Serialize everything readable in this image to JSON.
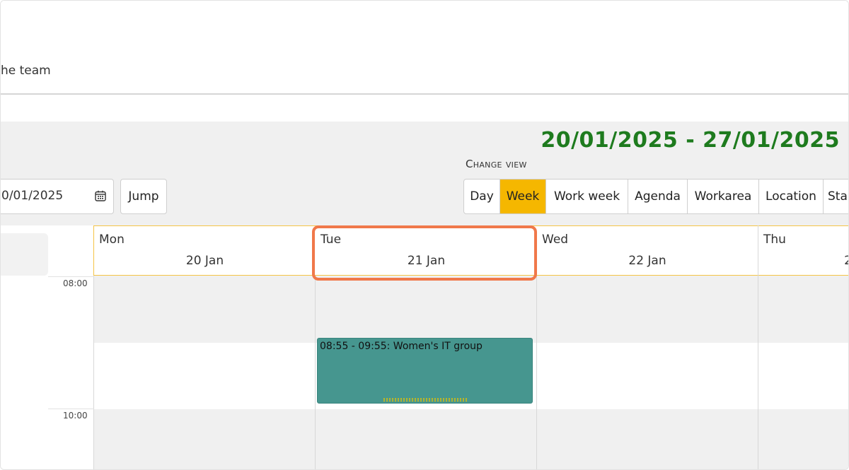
{
  "header": {
    "team_text": "he team"
  },
  "toolbar": {
    "date_range": "20/01/2025 - 27/01/2025",
    "change_view_label": "Change view",
    "date_input_value": "0/01/2025",
    "jump_label": "Jump",
    "views": [
      "Day",
      "Week",
      "Work week",
      "Agenda",
      "Workarea",
      "Location",
      "Sta"
    ],
    "active_view": "Week"
  },
  "calendar": {
    "days": [
      {
        "name": "Mon",
        "date": "20 Jan"
      },
      {
        "name": "Tue",
        "date": "21 Jan"
      },
      {
        "name": "Wed",
        "date": "22 Jan"
      },
      {
        "name": "Thu",
        "date": "2"
      }
    ],
    "times": [
      "08:00",
      "10:00"
    ],
    "event": {
      "label": "08:55 - 09:55: Women's IT group",
      "color": "#46968f"
    }
  },
  "colors": {
    "accent": "#f5b700",
    "date_range": "#1e7b1e",
    "highlight": "#f0784a"
  }
}
